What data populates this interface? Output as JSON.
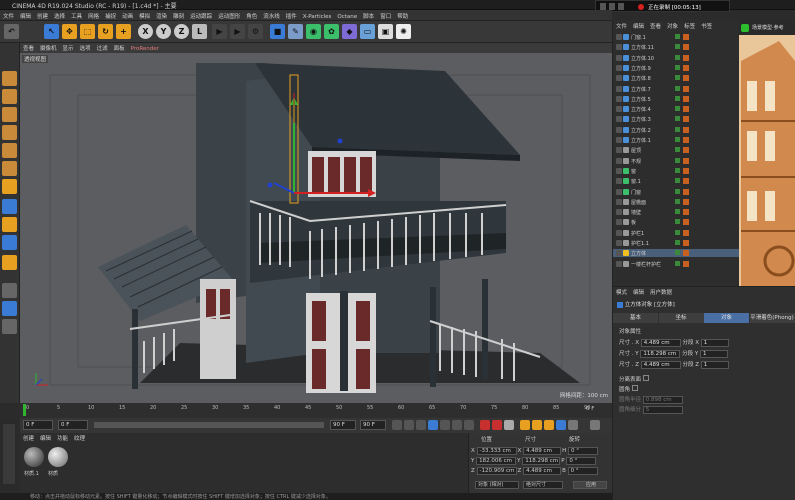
{
  "window": {
    "title": "CINEMA 4D R19.024 Studio (RC - R19) - [1.c4d *] - 主要"
  },
  "recording": {
    "label": "正在录制 [00:05:13]"
  },
  "menu": [
    "文件",
    "编辑",
    "创建",
    "选择",
    "工具",
    "网格",
    "捕捉",
    "动画",
    "模拟",
    "渲染",
    "雕刻",
    "运动跟踪",
    "运动图形",
    "角色",
    "流水线",
    "插件",
    "X-Particles",
    "Octane",
    "脚本",
    "窗口",
    "帮助"
  ],
  "toolbar": {
    "axes": [
      "X",
      "Y",
      "Z"
    ]
  },
  "viewport": {
    "menu": [
      "查看",
      "摄像机",
      "显示",
      "选项",
      "过滤",
      "面板",
      "ProRender"
    ],
    "label": "透视视图",
    "grid_label": "网格间距：100 cm"
  },
  "timeline": {
    "ticks": [
      "0",
      "5",
      "10",
      "15",
      "20",
      "25",
      "30",
      "35",
      "40",
      "45",
      "50",
      "55",
      "60",
      "65",
      "70",
      "75",
      "80",
      "85",
      "90"
    ],
    "end": "0 F"
  },
  "transport": {
    "start": "0 F",
    "current": "0 F",
    "end": "90 F",
    "max": "90 F"
  },
  "material": {
    "menu": [
      "创建",
      "编辑",
      "功能",
      "纹理"
    ],
    "items": [
      "材质.1",
      "材质"
    ]
  },
  "coordinates": {
    "headers": [
      "位置",
      "尺寸",
      "旋转"
    ],
    "rows": [
      {
        "axis": "X",
        "pos": "-33.333 cm",
        "size": "4.489 cm",
        "rot_axis": "H",
        "rot": "0 °"
      },
      {
        "axis": "Y",
        "pos": "182.006 cm",
        "size": "118.298 cm",
        "rot_axis": "P",
        "rot": "0 °"
      },
      {
        "axis": "Z",
        "pos": "-120.909 cm",
        "size": "4.489 cm",
        "rot_axis": "B",
        "rot": "0 °"
      }
    ],
    "mode": "对象 (相对)",
    "size_mode": "绝对尺寸",
    "apply": "应用"
  },
  "status": {
    "text": "移动：点击并拖动鼠标移动元素。按住 SHIFT 键量化移动；节点编辑模式时按住 SHIFT 键增加选择对象；按住 CTRL 键减少选择对象。"
  },
  "objects": {
    "tabs": [
      "文件",
      "编辑",
      "查看",
      "对象",
      "标签",
      "书签"
    ],
    "items": [
      {
        "name": "门窗.1",
        "color": "#4a8fd8",
        "sel": false
      },
      {
        "name": "立方体.11",
        "color": "#4a8fd8",
        "sel": false
      },
      {
        "name": "立方体.10",
        "color": "#4a8fd8",
        "sel": false
      },
      {
        "name": "立方体.9",
        "color": "#4a8fd8",
        "sel": false
      },
      {
        "name": "立方体.8",
        "color": "#4a8fd8",
        "sel": false
      },
      {
        "name": "立方体.7",
        "color": "#4a8fd8",
        "sel": false
      },
      {
        "name": "立方体.5",
        "color": "#4a8fd8",
        "sel": false
      },
      {
        "name": "立方体.4",
        "color": "#4a8fd8",
        "sel": false
      },
      {
        "name": "立方体.3",
        "color": "#4a8fd8",
        "sel": false
      },
      {
        "name": "立方体.2",
        "color": "#4a8fd8",
        "sel": false
      },
      {
        "name": "立方体.1",
        "color": "#4a8fd8",
        "sel": false
      },
      {
        "name": "屋顶",
        "color": "#999",
        "sel": false
      },
      {
        "name": "不规",
        "color": "#999",
        "sel": false
      },
      {
        "name": "窗",
        "color": "#3bbf6a",
        "sel": false
      },
      {
        "name": "窗.1",
        "color": "#3bbf6a",
        "sel": false
      },
      {
        "name": "门窗",
        "color": "#3bbf6a",
        "sel": false
      },
      {
        "name": "屋檐面",
        "color": "#999",
        "sel": false
      },
      {
        "name": "墙壁",
        "color": "#999",
        "sel": false
      },
      {
        "name": "板",
        "color": "#999",
        "sel": false
      },
      {
        "name": "护栏1",
        "color": "#999",
        "sel": false
      },
      {
        "name": "护栏1.1",
        "color": "#999",
        "sel": false
      },
      {
        "name": "立方体",
        "color": "#f0c020",
        "sel": true
      },
      {
        "name": "一楼栏杆护栏",
        "color": "#999",
        "sel": false
      }
    ]
  },
  "attributes": {
    "menu": [
      "模式",
      "编辑",
      "用户数据"
    ],
    "object_title": "立方体对象 [立方体]",
    "tabs": [
      "基本",
      "坐标",
      "对象",
      "平滑着色(Phong)"
    ],
    "section": "对象属性",
    "rows": [
      {
        "label": "尺寸 . X",
        "value": "4.489 cm",
        "seg_label": "分段 X",
        "seg": "1"
      },
      {
        "label": "尺寸 . Y",
        "value": "118.298 cm",
        "seg_label": "分段 Y",
        "seg": "1"
      },
      {
        "label": "尺寸 . Z",
        "value": "4.489 cm",
        "seg_label": "分段 Z",
        "seg": "1"
      }
    ],
    "checks": [
      {
        "label": "分离表面"
      },
      {
        "label": "圆角"
      },
      {
        "label": "圆角半径",
        "value": "0.898 cm"
      },
      {
        "label": "圆角细分",
        "value": "5"
      }
    ]
  },
  "thumbnail": {
    "caption": "场景模型·参考"
  }
}
